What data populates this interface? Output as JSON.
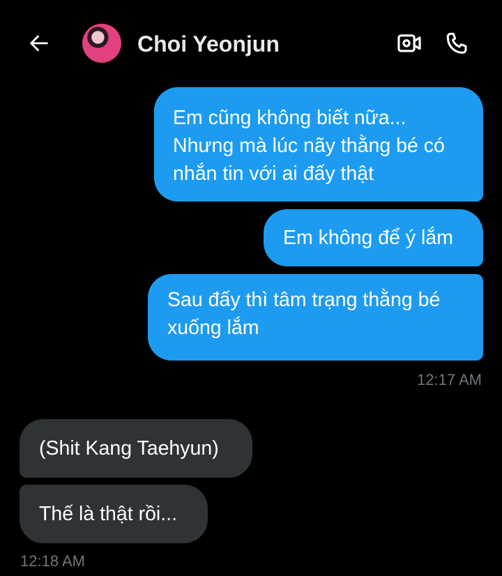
{
  "header": {
    "back_icon": "arrow-left-icon",
    "contact_name": "Choi Yeonjun",
    "video_icon": "video-call-icon",
    "phone_icon": "phone-icon"
  },
  "messages": [
    {
      "direction": "outgoing",
      "lines": [
        "Em cũng không biết nữa...",
        "Nhưng mà lúc nãy thằng bé có",
        "nhắn tin với ai đấy thật"
      ]
    },
    {
      "direction": "outgoing",
      "lines": [
        "Em không để ý lắm"
      ]
    },
    {
      "direction": "outgoing",
      "lines": [
        "Sau đấy thì tâm trạng thằng bé",
        "xuống lắm"
      ]
    },
    {
      "direction": "incoming",
      "lines": [
        "(Shit Kang Taehyun)"
      ]
    },
    {
      "direction": "incoming",
      "lines": [
        "Thế là thật rồi..."
      ]
    }
  ],
  "timestamps": {
    "outgoing_group": "12:17 AM",
    "incoming_group": "12:18 AM"
  },
  "colors": {
    "background": "#000000",
    "outgoing_bubble": "#1d9bf0",
    "incoming_bubble": "#2f3336",
    "timestamp": "#71767b"
  }
}
